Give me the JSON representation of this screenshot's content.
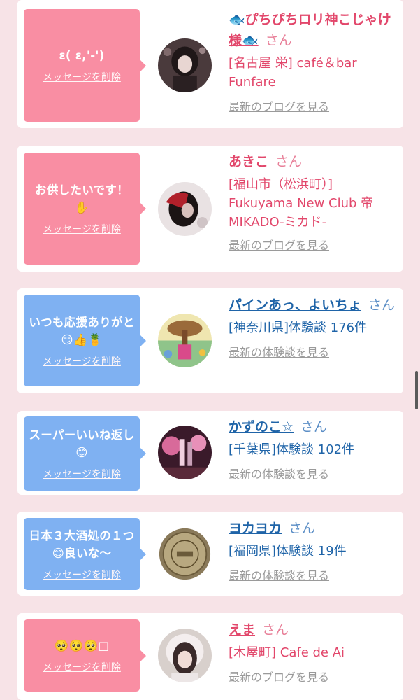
{
  "feed": [
    {
      "theme": "pink",
      "message": "ε( ε,'-')",
      "delete_label": "メッセージを削除",
      "avatar": "avatar-photo",
      "name": "🐟ぴちぴちロリ神こじゃけ様🐟",
      "honorific": "さん",
      "detail": "[名古屋 栄] café＆bar Funfare",
      "link": "最新のブログを見る"
    },
    {
      "theme": "pink",
      "message": "お供したいです！✋",
      "delete_label": "メッセージを削除",
      "avatar": "avatar-photo",
      "name": "あきこ",
      "honorific": "さん",
      "detail": "[福山市（松浜町）] Fukuyama New Club 帝 MIKADO-ミカド-",
      "link": "最新のブログを見る"
    },
    {
      "theme": "blue",
      "message": "いつも応援ありがと😏👍🍍",
      "delete_label": "メッセージを削除",
      "avatar": "avatar-drawing",
      "name": "パインあっ、よいちょ",
      "honorific": "さん",
      "detail": "[神奈川県]体験談 176件",
      "link": "最新の体験談を見る"
    },
    {
      "theme": "blue",
      "message": "スーパーいいね返し😊",
      "delete_label": "メッセージを削除",
      "avatar": "avatar-photo",
      "name": "かずのこ☆",
      "honorific": "さん",
      "detail": "[千葉県]体験談 102件",
      "link": "最新の体験談を見る"
    },
    {
      "theme": "blue",
      "message": "日本３大酒処の１つ😊良いな〜",
      "delete_label": "メッセージを削除",
      "avatar": "avatar-coin",
      "name": "ヨカヨカ",
      "honorific": "さん",
      "detail": "[福岡県]体験談 19件",
      "link": "最新の体験談を見る"
    },
    {
      "theme": "pink",
      "message": "🥺🥺🥺□",
      "delete_label": "メッセージを削除",
      "avatar": "avatar-photo",
      "name": "えま",
      "honorific": "さん",
      "detail": "[木屋町] Cafe de Ai",
      "link": "最新のブログを見る"
    }
  ]
}
